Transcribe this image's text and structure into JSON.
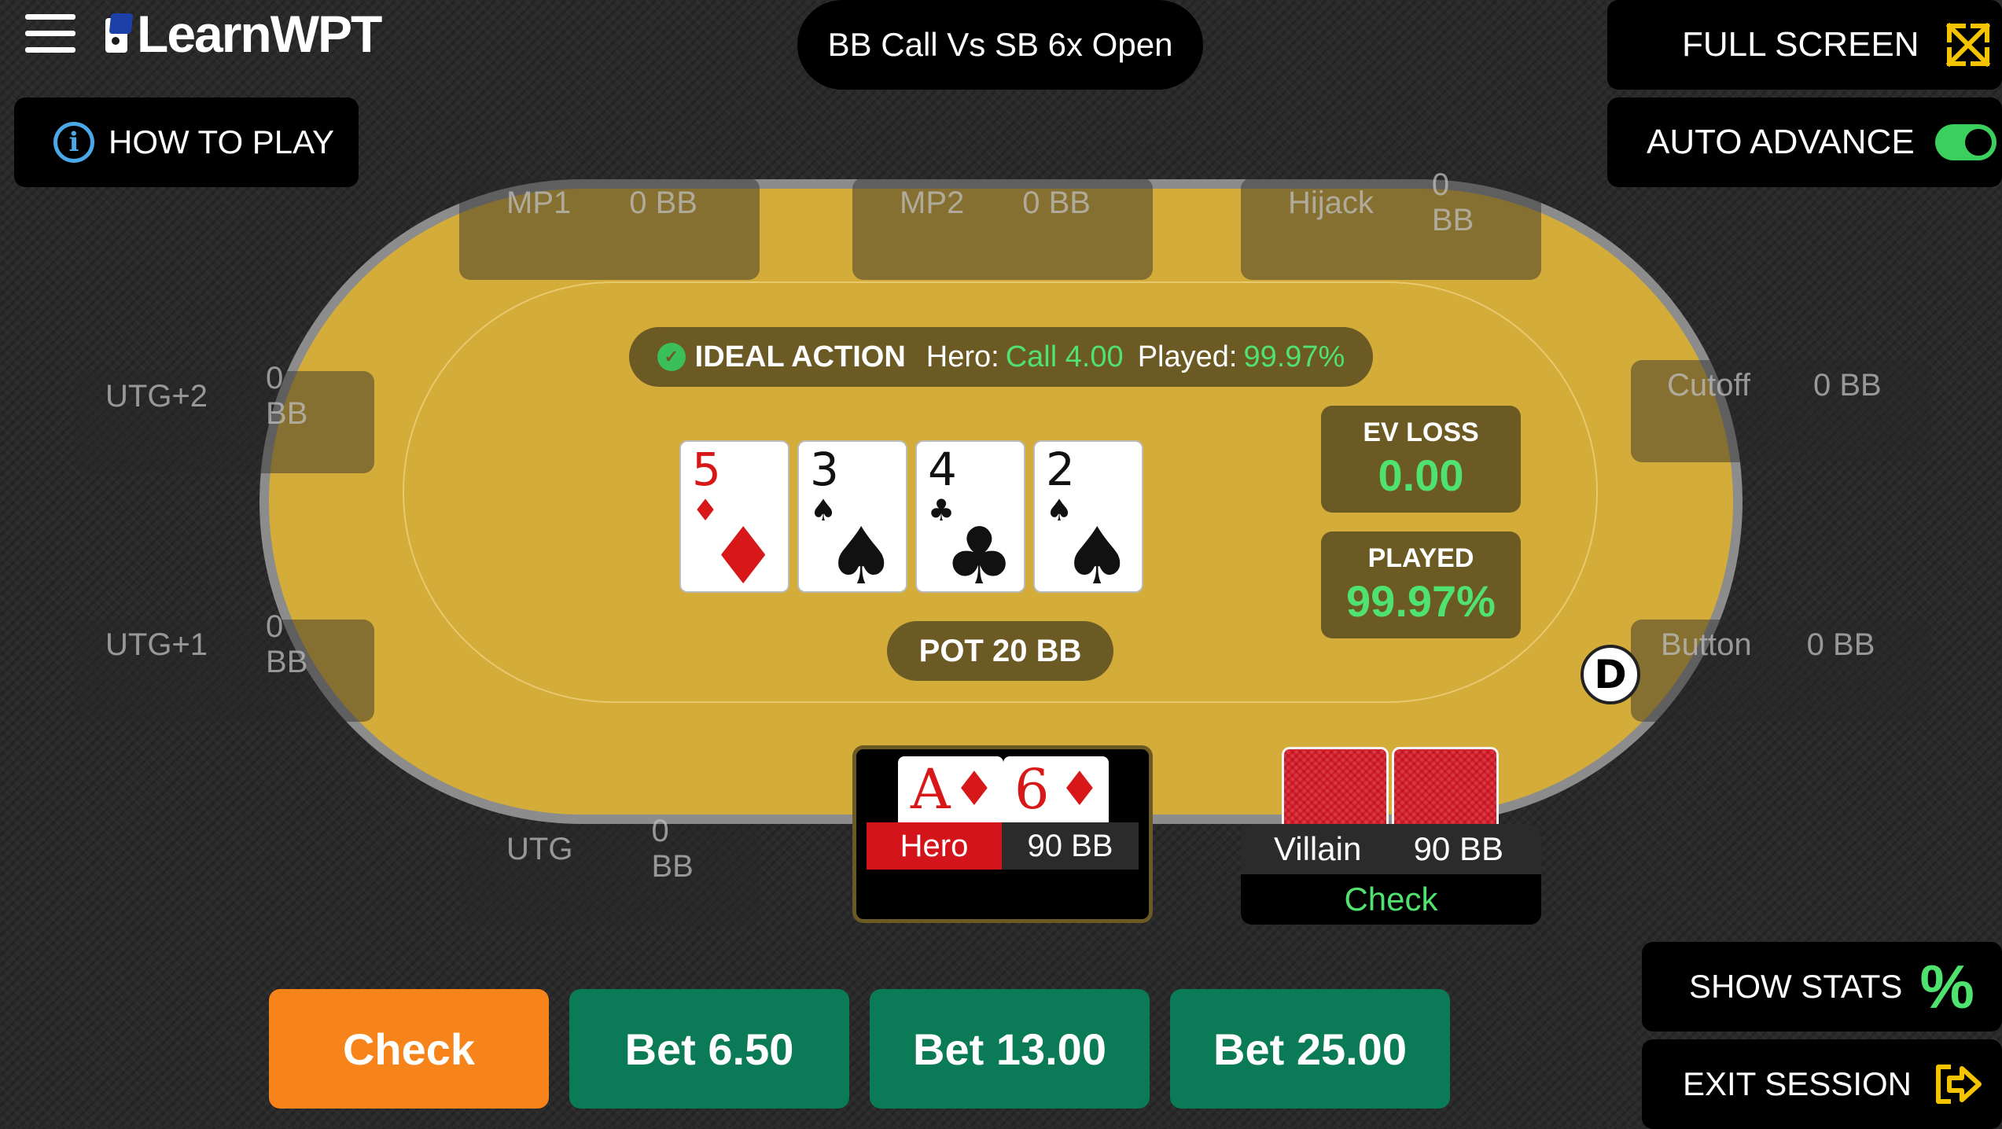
{
  "header": {
    "brand": "LearnWPT",
    "scenario_title": "BB Call Vs SB 6x Open",
    "how_to_play": "HOW TO PLAY",
    "full_screen": "FULL SCREEN",
    "auto_advance": "AUTO ADVANCE",
    "auto_advance_on": true
  },
  "seats": {
    "mp1": {
      "name": "MP1",
      "stack": "0 BB"
    },
    "mp2": {
      "name": "MP2",
      "stack": "0 BB"
    },
    "hijack": {
      "name": "Hijack",
      "stack": "0 BB"
    },
    "utg2": {
      "name": "UTG+2",
      "stack": "0 BB"
    },
    "utg1": {
      "name": "UTG+1",
      "stack": "0 BB"
    },
    "cutoff": {
      "name": "Cutoff",
      "stack": "0 BB"
    },
    "button": {
      "name": "Button",
      "stack": "0 BB"
    },
    "utg": {
      "name": "UTG",
      "stack": "0 BB"
    }
  },
  "ideal_action": {
    "label": "IDEAL ACTION",
    "hero_label": "Hero:",
    "hero_value": "Call 4.00",
    "played_label": "Played:",
    "played_value": "99.97%"
  },
  "board": [
    {
      "rank": "5",
      "suit": "♦",
      "color": "red"
    },
    {
      "rank": "3",
      "suit": "♠",
      "color": "black"
    },
    {
      "rank": "4",
      "suit": "♣",
      "color": "black"
    },
    {
      "rank": "2",
      "suit": "♠",
      "color": "black"
    }
  ],
  "stats": {
    "ev_loss_label": "EV LOSS",
    "ev_loss_value": "0.00",
    "played_label": "PLAYED",
    "played_value": "99.97%"
  },
  "pot": "POT 20 BB",
  "dealer_button": "D",
  "hero": {
    "name": "Hero",
    "stack": "90 BB",
    "cards": [
      {
        "rank": "A",
        "suit": "♦"
      },
      {
        "rank": "6",
        "suit": "♦"
      }
    ]
  },
  "villain": {
    "name": "Villain",
    "stack": "90 BB",
    "action": "Check"
  },
  "actions": [
    "Check",
    "Bet 6.50",
    "Bet 13.00",
    "Bet 25.00"
  ],
  "side_buttons": {
    "show_stats": "SHOW STATS",
    "show_stats_icon": "%",
    "exit_session": "EXIT SESSION"
  },
  "colors": {
    "felt": "#d3ac3a",
    "panel": "#6b5a23",
    "accent_green": "#4fe26e",
    "check_orange": "#f7841a",
    "bet_green": "#0b7a56",
    "hero_red": "#d3141a",
    "icon_yellow": "#f5c400"
  }
}
